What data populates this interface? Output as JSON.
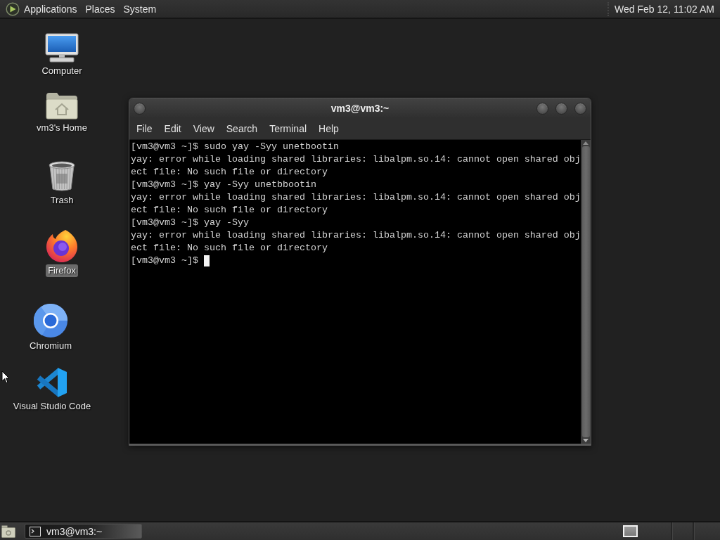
{
  "top_panel": {
    "menus": [
      "Applications",
      "Places",
      "System"
    ],
    "clock": "Wed Feb 12, 11:02 AM"
  },
  "desktop_icons": [
    {
      "kind": "computer",
      "label": "Computer",
      "selected": false
    },
    {
      "kind": "home",
      "label": "vm3's Home",
      "selected": false
    },
    {
      "kind": "trash",
      "label": "Trash",
      "selected": false
    },
    {
      "kind": "firefox",
      "label": "Firefox",
      "selected": true
    },
    {
      "kind": "chromium",
      "label": "Chromium",
      "selected": false
    },
    {
      "kind": "vscode",
      "label": "Visual Studio Code",
      "selected": false
    }
  ],
  "terminal_window": {
    "title": "vm3@vm3:~",
    "menus": [
      "File",
      "Edit",
      "View",
      "Search",
      "Terminal",
      "Help"
    ],
    "lines": [
      "[vm3@vm3 ~]$ sudo yay -Syy unetbootin",
      "yay: error while loading shared libraries: libalpm.so.14: cannot open shared obj",
      "ect file: No such file or directory",
      "[vm3@vm3 ~]$ yay -Syy unetbbootin",
      "yay: error while loading shared libraries: libalpm.so.14: cannot open shared obj",
      "ect file: No such file or directory",
      "[vm3@vm3 ~]$ yay -Syy",
      "yay: error while loading shared libraries: libalpm.so.14: cannot open shared obj",
      "ect file: No such file or directory",
      "[vm3@vm3 ~]$"
    ],
    "cursor": true
  },
  "taskbar": {
    "tasks": [
      {
        "label": "vm3@vm3:~"
      }
    ]
  }
}
